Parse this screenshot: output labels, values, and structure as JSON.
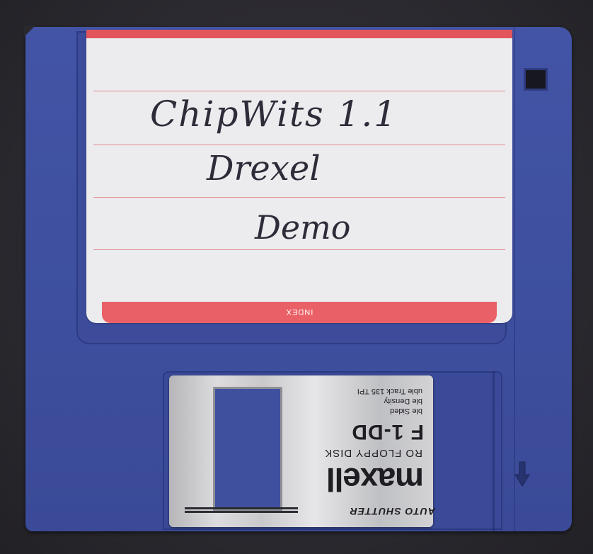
{
  "scene": {
    "description_colors": {
      "background": "#2a292e",
      "disk_body": "#4354a6",
      "label_paper": "#ecebed",
      "label_band": "#ea6067",
      "shutter_metal": "#d3d3d6"
    }
  },
  "label": {
    "handwriting": {
      "line1": "ChipWits 1.1",
      "line2": "Drexel",
      "line3": "Demo"
    },
    "band_text": "INDEX"
  },
  "shutter": {
    "auto_shutter": "AUTO SHUTTER",
    "brand": "maxell",
    "micro_text": "RO FLOPPY DISK",
    "model": "F 1-DD",
    "spec_lines": [
      "ble Sided",
      "ble Density",
      "uble Track 135 TPI"
    ]
  },
  "icons": {
    "arrow": "insert-direction-arrow-icon",
    "write_protect": "write-protect-notch-icon"
  }
}
